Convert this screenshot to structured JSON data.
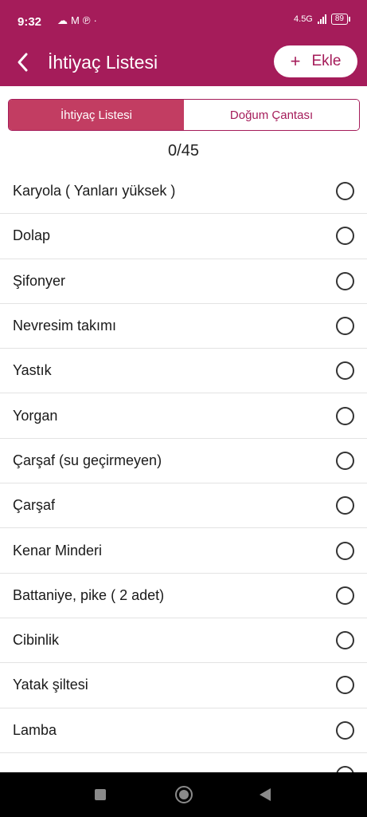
{
  "status": {
    "time": "9:32",
    "icons": [
      "cloud-icon",
      "gmail-icon",
      "pinterest-icon",
      "dot-icon"
    ],
    "network": "4.5G",
    "battery": "89"
  },
  "header": {
    "title": "İhtiyaç Listesi",
    "add_label": "Ekle",
    "add_icon": "plus-icon"
  },
  "tabs": [
    {
      "label": "İhtiyaç Listesi",
      "active": true
    },
    {
      "label": "Doğum Çantası",
      "active": false
    }
  ],
  "counter": "0/45",
  "items": [
    {
      "label": "Karyola ( Yanları yüksek )",
      "checked": false
    },
    {
      "label": "Dolap",
      "checked": false
    },
    {
      "label": "Şifonyer",
      "checked": false
    },
    {
      "label": "Nevresim takımı",
      "checked": false
    },
    {
      "label": "Yastık",
      "checked": false
    },
    {
      "label": "Yorgan",
      "checked": false
    },
    {
      "label": "Çarşaf (su geçirmeyen)",
      "checked": false
    },
    {
      "label": "Çarşaf",
      "checked": false
    },
    {
      "label": "Kenar Minderi",
      "checked": false
    },
    {
      "label": "Battaniye, pike ( 2 adet)",
      "checked": false
    },
    {
      "label": "Cibinlik",
      "checked": false
    },
    {
      "label": "Yatak şiltesi",
      "checked": false
    },
    {
      "label": "Lamba",
      "checked": false
    }
  ],
  "colors": {
    "brand": "#a51c5a",
    "tab_active": "#c23d62"
  }
}
